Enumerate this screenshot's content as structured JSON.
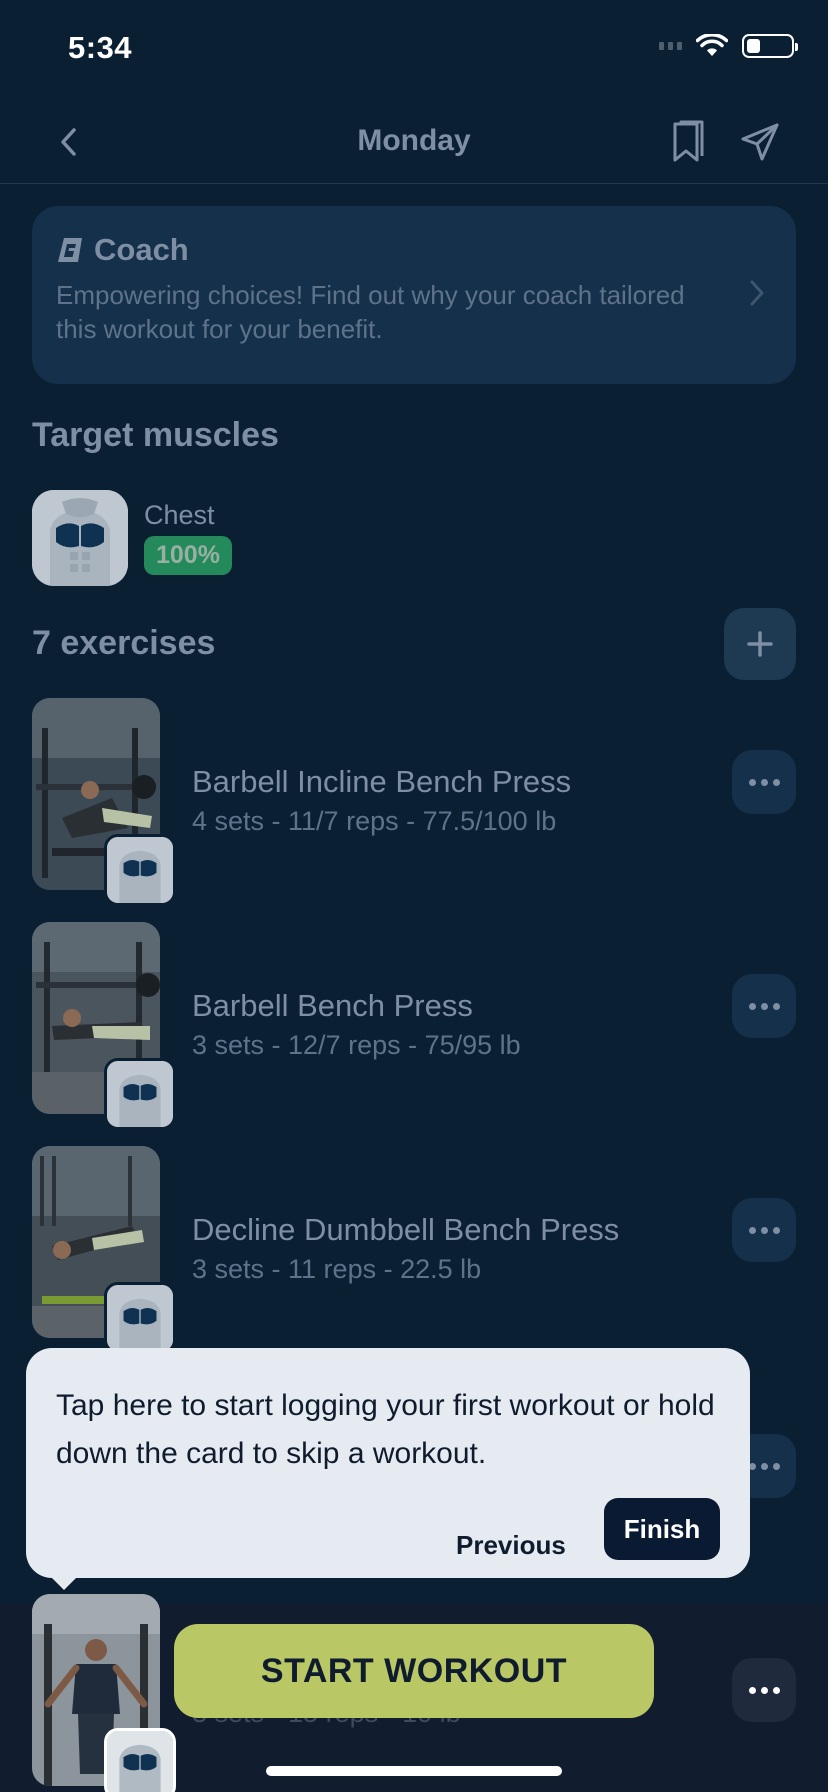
{
  "status_bar": {
    "time": "5:34"
  },
  "header": {
    "title": "Monday"
  },
  "coach": {
    "title": "Coach",
    "text": "Empowering choices! Find out why your coach tailored this workout for your benefit."
  },
  "target_muscles": {
    "title": "Target muscles",
    "items": [
      {
        "name": "Chest",
        "percent": "100%"
      }
    ]
  },
  "exercises": {
    "title": "7 exercises",
    "items": [
      {
        "name": "Barbell Incline Bench Press",
        "meta": "4 sets - 11/7 reps - 77.5/100 lb"
      },
      {
        "name": "Barbell Bench Press",
        "meta": "3 sets - 12/7 reps - 75/95 lb"
      },
      {
        "name": "Decline Dumbbell Bench Press",
        "meta": "3 sets - 11 reps - 22.5 lb"
      },
      {
        "name": "",
        "meta": "3 sets - 15 reps - 10 lb"
      }
    ]
  },
  "tooltip": {
    "text": "Tap here to start logging your first workout or hold down the card to skip a workout.",
    "previous_label": "Previous",
    "finish_label": "Finish"
  },
  "start_button": {
    "label": "START WORKOUT"
  },
  "colors": {
    "background": "#0b1f33",
    "card": "#15304a",
    "accent": "#b9c764",
    "badge_green": "#248a5c"
  },
  "icons": [
    "back-icon",
    "bookmark-icon",
    "send-icon",
    "coach-logo-icon",
    "chevron-right-icon",
    "plus-icon",
    "more-icon"
  ]
}
